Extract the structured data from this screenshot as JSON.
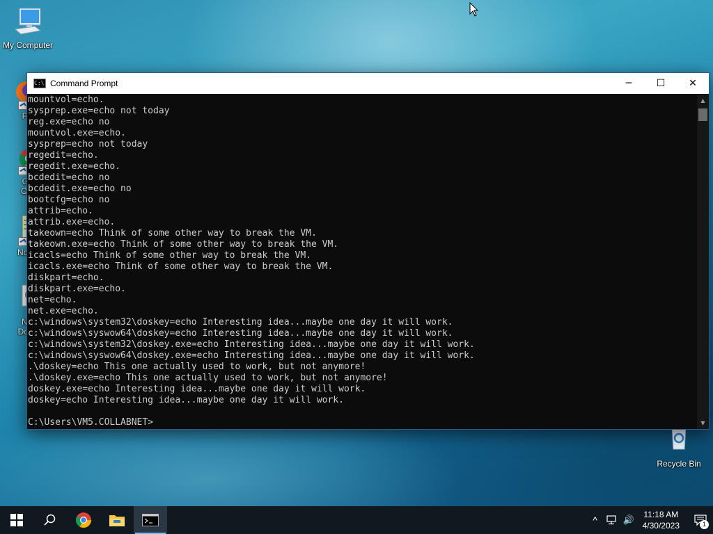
{
  "desktop": {
    "icons": [
      {
        "id": "my-computer",
        "label": "My Computer"
      },
      {
        "id": "firefox",
        "label": "Fire"
      },
      {
        "id": "chrome",
        "label1": "Goo",
        "label2": "Chro"
      },
      {
        "id": "notepad",
        "label": "Notep"
      },
      {
        "id": "new-doc",
        "label1": "New",
        "label2": "Docun"
      },
      {
        "id": "recycle-bin",
        "label": "Recycle Bin"
      }
    ]
  },
  "window": {
    "title": "Command Prompt",
    "icon_text": "C:\\",
    "minimize_glyph": "─",
    "maximize_glyph": "☐",
    "close_glyph": "✕",
    "lines": [
      "mountvol=echo.",
      "sysprep.exe=echo not today",
      "reg.exe=echo no",
      "mountvol.exe=echo.",
      "sysprep=echo not today",
      "regedit=echo.",
      "regedit.exe=echo.",
      "bcdedit=echo no",
      "bcdedit.exe=echo no",
      "bootcfg=echo no",
      "attrib=echo.",
      "attrib.exe=echo.",
      "takeown=echo Think of some other way to break the VM.",
      "takeown.exe=echo Think of some other way to break the VM.",
      "icacls=echo Think of some other way to break the VM.",
      "icacls.exe=echo Think of some other way to break the VM.",
      "diskpart=echo.",
      "diskpart.exe=echo.",
      "net=echo.",
      "net.exe=echo.",
      "c:\\windows\\system32\\doskey=echo Interesting idea...maybe one day it will work.",
      "c:\\windows\\syswow64\\doskey=echo Interesting idea...maybe one day it will work.",
      "c:\\windows\\system32\\doskey.exe=echo Interesting idea...maybe one day it will work.",
      "c:\\windows\\syswow64\\doskey.exe=echo Interesting idea...maybe one day it will work.",
      ".\\doskey=echo This one actually used to work, but not anymore!",
      ".\\doskey.exe=echo This one actually used to work, but not anymore!",
      "doskey.exe=echo Interesting idea...maybe one day it will work.",
      "doskey=echo Interesting idea...maybe one day it will work.",
      "",
      "C:\\Users\\VM5.COLLABNET>"
    ],
    "scroll_up": "▲",
    "scroll_down": "▼"
  },
  "taskbar": {
    "apps": [
      "start",
      "search",
      "chrome",
      "file-explorer",
      "command-prompt"
    ],
    "active_app": "command-prompt",
    "clock_time": "11:18 AM",
    "clock_date": "4/30/2023",
    "notification_count": "1",
    "tray_chevron": "^",
    "tray_volume": "🔊"
  },
  "colors": {
    "console_bg": "#0c0c0c",
    "console_text": "#cccccc",
    "taskbar_bg": "#101820",
    "accent": "#76b9ed"
  }
}
